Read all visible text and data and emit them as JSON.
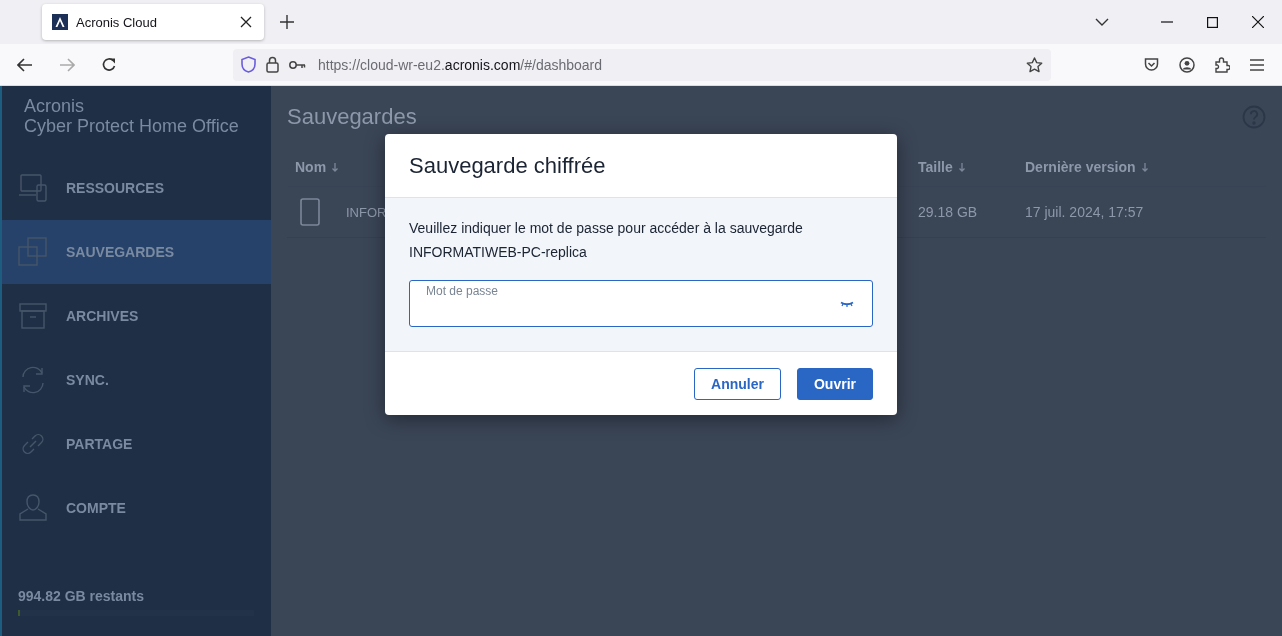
{
  "browser": {
    "tab_title": "Acronis Cloud",
    "url": {
      "before": "https://cloud-wr-eu2.",
      "domain": "acronis.com",
      "after": "/#/dashboard"
    }
  },
  "sidebar": {
    "brand": "Acronis",
    "product": "Cyber Protect Home Office",
    "items": [
      {
        "label": "RESSOURCES",
        "kind": "devices",
        "selected": false
      },
      {
        "label": "SAUVEGARDES",
        "kind": "backups",
        "selected": true
      },
      {
        "label": "ARCHIVES",
        "kind": "archive",
        "selected": false
      },
      {
        "label": "SYNC.",
        "kind": "sync",
        "selected": false
      },
      {
        "label": "PARTAGE",
        "kind": "link",
        "selected": false
      },
      {
        "label": "COMPTE",
        "kind": "person",
        "selected": false
      }
    ],
    "storage": {
      "text": "994.82 GB restants",
      "level": 0.01
    }
  },
  "main": {
    "title": "Sauvegardes",
    "table": {
      "columns": [
        "Nom",
        "Taille",
        "Dernière version"
      ],
      "rows": [
        {
          "name": "INFOR",
          "size": "29.18 GB",
          "date": "17 juil. 2024, 17:57"
        }
      ]
    }
  },
  "dialog": {
    "title": "Sauvegarde chiffrée",
    "message": "Veuillez indiquer le mot de passe pour accéder à la sauvegarde INFORMATIWEB-PC-replica",
    "field_label": "Mot de passe",
    "buttons": [
      "Annuler",
      "Ouvrir"
    ]
  }
}
